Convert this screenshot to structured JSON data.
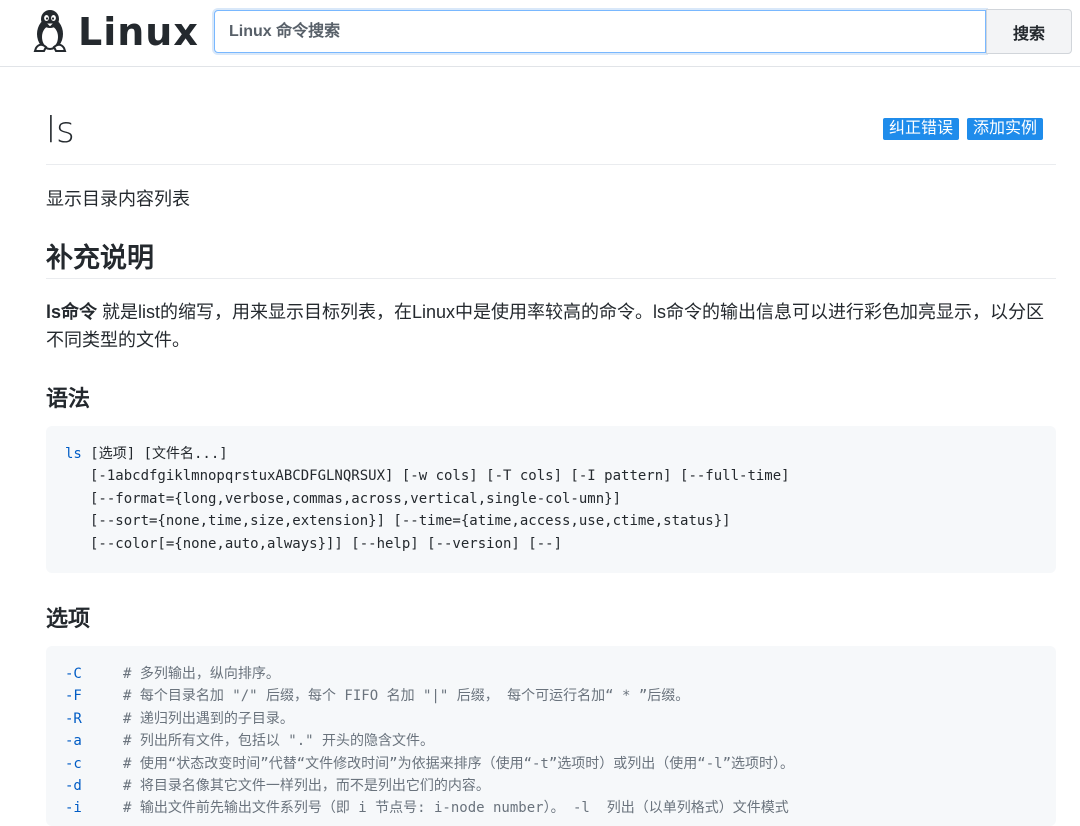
{
  "header": {
    "logo_text": "Linux",
    "logo_icon": "tux-penguin-icon",
    "search_placeholder": "Linux 命令搜索",
    "search_button": "搜索"
  },
  "page": {
    "title": "ls",
    "badges": {
      "fix": "纠正错误",
      "add": "添加实例"
    },
    "summary": "显示目录内容列表"
  },
  "section_supplement": {
    "heading": "补充说明",
    "strong": "ls命令",
    "text": " 就是list的缩写，用来显示目标列表，在Linux中是使用率较高的命令。ls命令的输出信息可以进行彩色加亮显示，以分区不同类型的文件。"
  },
  "section_syntax": {
    "heading": "语法",
    "line1_cmd": "ls",
    "line1_rest": " [选项] [文件名...]",
    "line2": "[-1abcdfgiklmnopqrstuxABCDFGLNQRSUX] [-w cols] [-T cols] [-I pattern] [--full-time]",
    "line3": "[--format={long,verbose,commas,across,vertical,single-col-umn}]",
    "line4": "[--sort={none,time,size,extension}] [--time={atime,access,use,ctime,status}]",
    "line5": "[--color[={none,auto,always}]] [--help] [--version] [--]"
  },
  "section_options": {
    "heading": "选项",
    "items": [
      {
        "flag": "-C",
        "comment": "# 多列输出，纵向排序。"
      },
      {
        "flag": "-F",
        "comment": "# 每个目录名加 \"/\" 后缀，每个 FIFO 名加 \"|\" 后缀， 每个可运行名加“ * ”后缀。"
      },
      {
        "flag": "-R",
        "comment": "# 递归列出遇到的子目录。"
      },
      {
        "flag": "-a",
        "comment": "# 列出所有文件，包括以 \".\" 开头的隐含文件。"
      },
      {
        "flag": "-c",
        "comment": "# 使用“状态改变时间”代替“文件修改时间”为依据来排序（使用“-t”选项时）或列出（使用“-l”选项时）。"
      },
      {
        "flag": "-d",
        "comment": "# 将目录名像其它文件一样列出，而不是列出它们的内容。"
      },
      {
        "flag": "-i",
        "comment": "# 输出文件前先输出文件系列号（即 i 节点号: i-node number）。 -l  列出（以单列格式）文件模式"
      }
    ]
  }
}
